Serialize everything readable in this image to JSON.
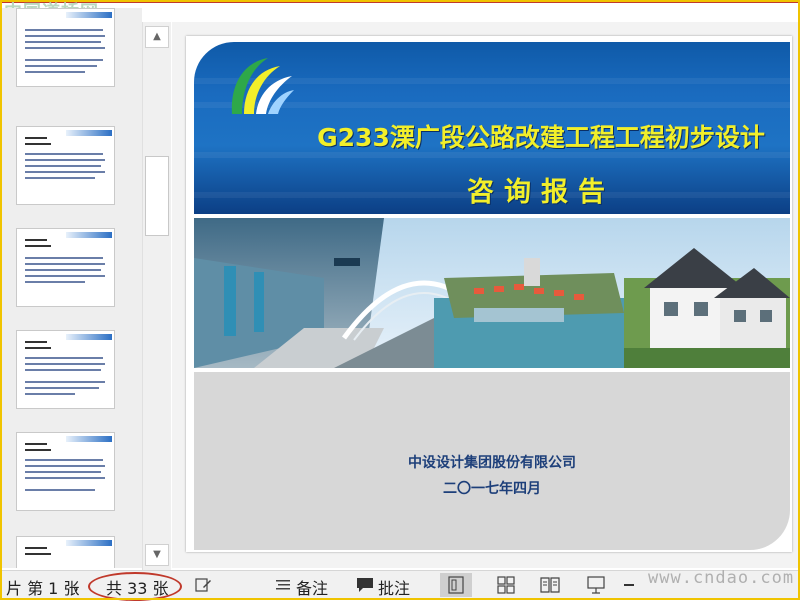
{
  "watermarks": {
    "top": "中国道桥网",
    "bottom": "www.cndao.com"
  },
  "slide": {
    "title_line1": "G233溧广段公路改建工程工程初步设计",
    "title_line2": "咨询报告",
    "company": "中设设计集团股份有限公司",
    "date": "二〇一七年四月"
  },
  "statusbar": {
    "slide_pos": "片 第 1 张",
    "total": "共 33 张",
    "notes_label": "备注",
    "comments_label": "批注"
  },
  "icons": [
    "scroll-up-icon",
    "scroll-down-icon",
    "notes-icon",
    "comments-icon",
    "edit-icon",
    "normal-view-icon",
    "sorter-view-icon",
    "reading-view-icon",
    "slideshow-icon"
  ],
  "colors": {
    "title_yellow": "#f2ef2a",
    "banner_blue": "#1a6bbf",
    "highlight_red": "#c0392b",
    "frame_yellow": "#f0c400"
  }
}
